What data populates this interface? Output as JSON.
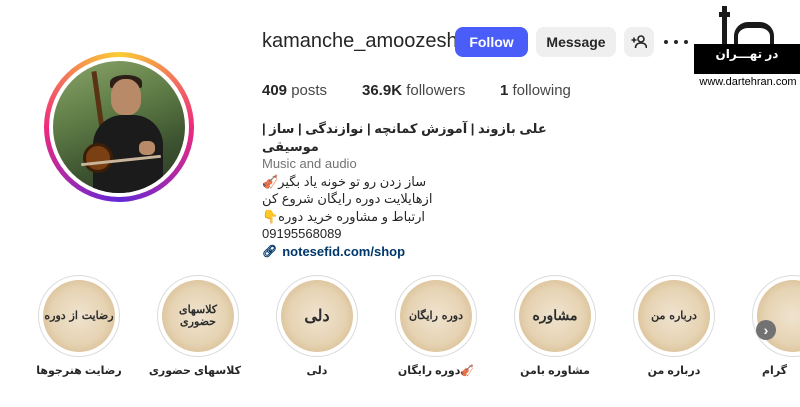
{
  "profile": {
    "username": "kamanche_amoozesh",
    "follow_label": "Follow",
    "message_label": "Message",
    "suggest_icon": "+👤",
    "more_icon": "more-options"
  },
  "stats": {
    "posts_count": "409",
    "posts_label": "posts",
    "followers_count": "36.9K",
    "followers_label": "followers",
    "following_count": "1",
    "following_label": "following"
  },
  "bio": {
    "name": "علی بازوند | آموزش کمانچه | نوازندگی | ساز | موسیقی",
    "category": "Music and audio",
    "line1": "ساز زدن رو تو خونه یاد بگیر🎻",
    "line2": "ازهایلایت دوره رایگان شروع کن",
    "line3": "ارتباط و مشاوره خرید دوره👇",
    "phone": "09195568089",
    "link": "notesefid.com/shop"
  },
  "logo": {
    "title": "در تهـــران",
    "url": "www.dartehran.com"
  },
  "highlights": [
    {
      "cover": "رضایت از دوره",
      "label": "رضایت هنرجوها"
    },
    {
      "cover": "کلاسهای حضوری",
      "label": "کلاسهای حضوری"
    },
    {
      "cover": "دلی",
      "label": "دلی"
    },
    {
      "cover": "دوره رایگان",
      "label": "🎻دوره رایگان"
    },
    {
      "cover": "مشاوره",
      "label": "مشاوره بامن"
    },
    {
      "cover": "درباره من",
      "label": "درباره من"
    }
  ],
  "highlight_partial_label": "گرام",
  "colors": {
    "follow_button": "#4a5df9",
    "secondary_button": "#efefef",
    "link": "#00376b"
  }
}
